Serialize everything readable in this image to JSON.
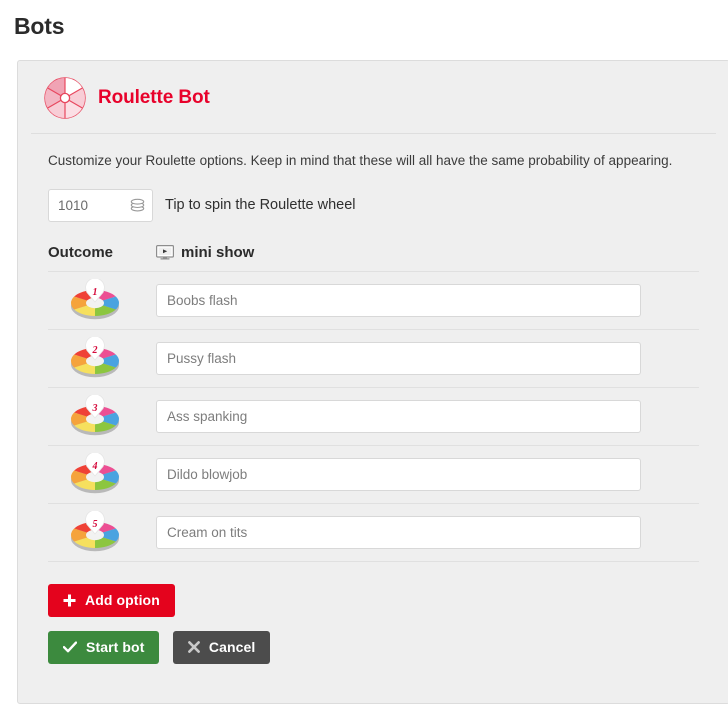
{
  "page": {
    "title": "Bots"
  },
  "bot": {
    "logo_icon": "roulette-wheel-icon",
    "title": "Roulette Bot",
    "description": "Customize your Roulette options. Keep in mind that these will all have the same probability of appearing.",
    "accent_color": "#e8022b"
  },
  "tip": {
    "value": "1010",
    "placeholder": "1010",
    "token_icon": "token-stack-icon",
    "label": "Tip to spin the Roulette wheel"
  },
  "columns": {
    "outcome_label": "Outcome",
    "show_icon": "monitor-play-icon",
    "show_label": "mini show"
  },
  "options": [
    {
      "number": "1",
      "icon": "roulette-wheel-color-icon",
      "value": "Boobs flash",
      "placeholder": "Boobs flash"
    },
    {
      "number": "2",
      "icon": "roulette-wheel-color-icon",
      "value": "Pussy flash",
      "placeholder": "Pussy flash"
    },
    {
      "number": "3",
      "icon": "roulette-wheel-color-icon",
      "value": "Ass spanking",
      "placeholder": "Ass spanking"
    },
    {
      "number": "4",
      "icon": "roulette-wheel-color-icon",
      "value": "Dildo blowjob",
      "placeholder": "Dildo blowjob"
    },
    {
      "number": "5",
      "icon": "roulette-wheel-color-icon",
      "value": "Cream on tits",
      "placeholder": "Cream on tits"
    }
  ],
  "buttons": {
    "add_option": {
      "label": "Add option",
      "icon": "plus-icon",
      "color": "#e4031d"
    },
    "start_bot": {
      "label": "Start bot",
      "icon": "check-icon",
      "color": "#3c8a3e"
    },
    "cancel": {
      "label": "Cancel",
      "icon": "close-icon",
      "color": "#4c4c4c"
    }
  }
}
